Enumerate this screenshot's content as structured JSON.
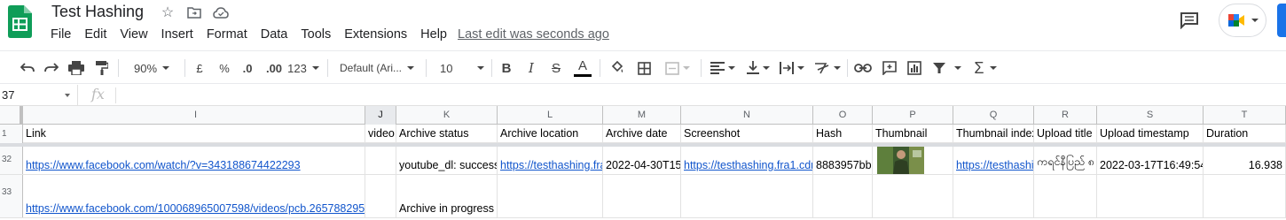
{
  "doc": {
    "title": "Test Hashing",
    "last_edit": "Last edit was seconds ago"
  },
  "menu": [
    "File",
    "Edit",
    "View",
    "Insert",
    "Format",
    "Data",
    "Tools",
    "Extensions",
    "Help"
  ],
  "toolbar": {
    "zoom": "90%",
    "currency": "£",
    "percent": "%",
    "dec_decrease": ".0",
    "dec_increase": ".00",
    "more_formats": "123",
    "font": "Default (Ari...",
    "font_size": "10"
  },
  "formula_bar": {
    "name_box": "37",
    "fx": "fx",
    "value": ""
  },
  "columns": [
    {
      "letter": "I",
      "header": "Link"
    },
    {
      "letter": "J",
      "header": "video"
    },
    {
      "letter": "K",
      "header": "Archive status"
    },
    {
      "letter": "L",
      "header": "Archive location"
    },
    {
      "letter": "M",
      "header": "Archive date"
    },
    {
      "letter": "N",
      "header": "Screenshot"
    },
    {
      "letter": "O",
      "header": "Hash"
    },
    {
      "letter": "P",
      "header": "Thumbnail"
    },
    {
      "letter": "Q",
      "header": "Thumbnail index"
    },
    {
      "letter": "R",
      "header": "Upload title"
    },
    {
      "letter": "S",
      "header": "Upload timestamp"
    },
    {
      "letter": "T",
      "header": "Duration"
    }
  ],
  "rows": [
    {
      "num": "1"
    },
    {
      "num": "32",
      "link": "https://www.facebook.com/watch/?v=343188674422293",
      "video": "",
      "archive_status": "youtube_dl: success",
      "archive_location": "https://testhashing.fra1.",
      "archive_date": "2022-04-30T15:",
      "screenshot": "https://testhashing.fra1.cdn",
      "hash": "8883957bba",
      "thumbnail_index": "https://testhashin",
      "upload_title": "ကရင်နီပြည် ၈",
      "upload_timestamp": "2022-03-17T16:49:54",
      "duration": "16.938"
    },
    {
      "num": "33",
      "link": "https://www.facebook.com/100068965007598/videos/pcb.265788295",
      "archive_status": "Archive in progress"
    }
  ],
  "colors": {
    "sheets_green": "#0f9d58",
    "link_blue": "#1155cc",
    "share_blue": "#1a73e8"
  }
}
